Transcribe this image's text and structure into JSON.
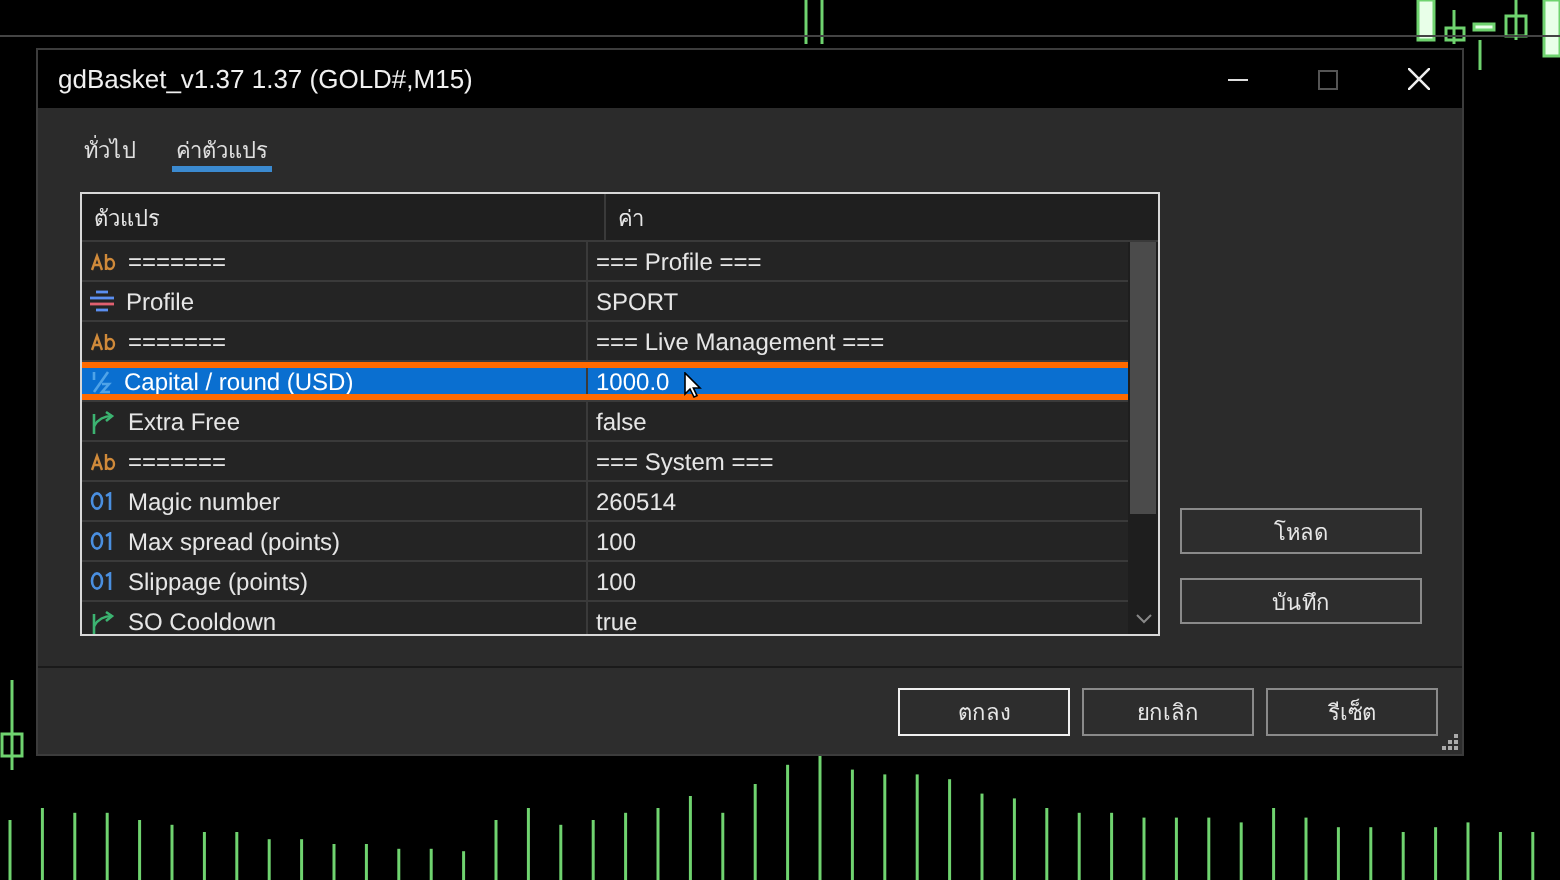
{
  "window": {
    "title": "gdBasket_v1.37 1.37 (GOLD#,M15)"
  },
  "tabs": [
    {
      "label": "ทั่วไป",
      "selected": false
    },
    {
      "label": "ค่าตัวแปร",
      "selected": true
    }
  ],
  "table": {
    "columns": [
      "ตัวแปร",
      "ค่า"
    ],
    "rows": [
      {
        "kind": "text",
        "name": "=======",
        "value": "=== Profile ===",
        "selected": false,
        "highlighted": false
      },
      {
        "kind": "enum",
        "name": "Profile",
        "value": "SPORT",
        "selected": false,
        "highlighted": false
      },
      {
        "kind": "text",
        "name": "=======",
        "value": "=== Live Management ===",
        "selected": false,
        "highlighted": false
      },
      {
        "kind": "double",
        "name": "Capital / round (USD)",
        "value": "1000.0",
        "selected": true,
        "highlighted": true
      },
      {
        "kind": "bool",
        "name": "Extra Free",
        "value": "false",
        "selected": false,
        "highlighted": false
      },
      {
        "kind": "text",
        "name": "=======",
        "value": "=== System ===",
        "selected": false,
        "highlighted": false
      },
      {
        "kind": "int",
        "name": "Magic number",
        "value": "260514",
        "selected": false,
        "highlighted": false
      },
      {
        "kind": "int",
        "name": "Max spread (points)",
        "value": "100",
        "selected": false,
        "highlighted": false
      },
      {
        "kind": "int",
        "name": "Slippage (points)",
        "value": "100",
        "selected": false,
        "highlighted": false
      },
      {
        "kind": "bool",
        "name": "SO Cooldown",
        "value": "true",
        "selected": false,
        "highlighted": false
      }
    ]
  },
  "side_buttons": [
    "โหลด",
    "บันทึก"
  ],
  "buttons": [
    {
      "label": "ตกลง",
      "default": true
    },
    {
      "label": "ยกเลิก",
      "default": false
    },
    {
      "label": "รีเซ็ต",
      "default": false
    }
  ]
}
